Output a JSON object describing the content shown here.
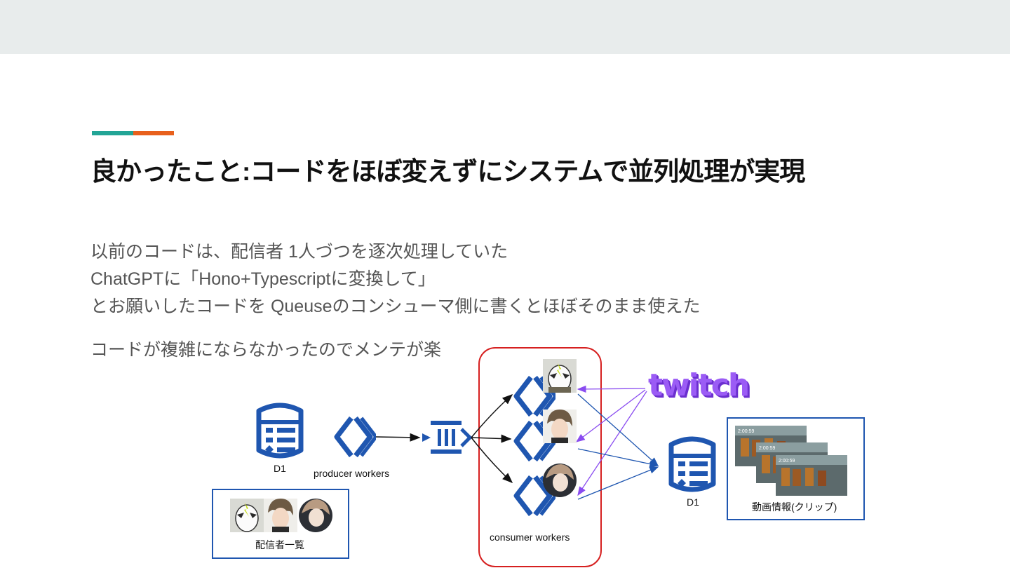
{
  "slide": {
    "title": "良かったこと:コードをほぼ変えずにシステムで並列処理が実現",
    "body_lines": [
      "以前のコードは、配信者 1人づつを逐次処理していた",
      "ChatGPTに「Hono+Typescriptに変換して」",
      "とお願いしたコードを Queuseのコンシューマ側に書くとほぼそのまま使えた"
    ],
    "note": "コードが複雑にならなかったのでメンテが楽"
  },
  "diagram": {
    "d1_left_label": "D1",
    "producer_label": "producer workers",
    "consumer_label": "consumer workers",
    "twitch_logo": "twitch",
    "d1_right_label": "D1",
    "streamers_list_label": "配信者一覧",
    "clips_label": "動画情報(クリップ)",
    "clip_timestamps": [
      "2:00:59",
      "2:00:59",
      "2:00:59"
    ],
    "colors": {
      "cloudflare_blue": "#1f56b0",
      "twitch_purple": "#9146ff",
      "consumer_box_red": "#d62020",
      "arrow_black": "#111111",
      "arrow_blue": "#1f56b0",
      "arrow_purple": "#8a4cf0"
    },
    "icons": [
      "d1-database-icon",
      "workers-icon",
      "queues-icon",
      "twitch-logo",
      "avatar-masked-wrestler",
      "avatar-man",
      "avatar-anime"
    ]
  }
}
